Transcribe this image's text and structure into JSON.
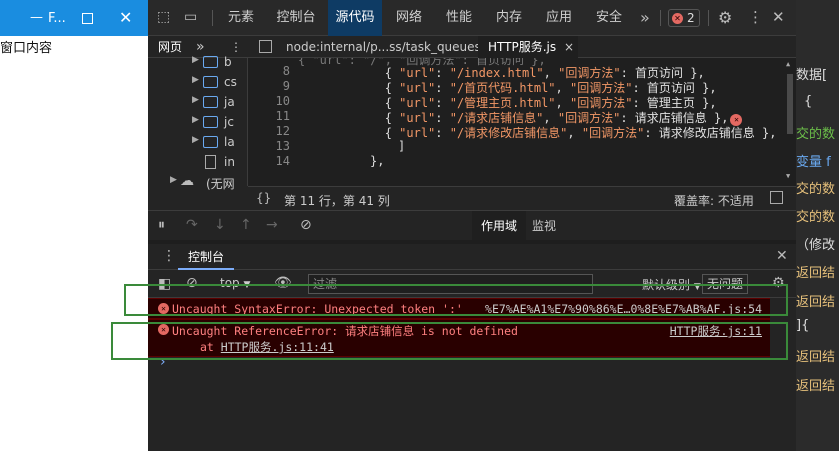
{
  "mini_window": {
    "title": "F...",
    "minimize": "—",
    "close": "✕",
    "content": "窗口内容"
  },
  "top_tabs": [
    "元素",
    "控制台",
    "源代码",
    "网络",
    "性能",
    "内存",
    "应用",
    "安全"
  ],
  "active_tab": "源代码",
  "error_badge": "2",
  "more_tabs": "»",
  "sub_bar": {
    "page_tab": "网页",
    "more": "»",
    "file_tab_1": "node:internal/p...ss/task_queues",
    "file_tab_2": "HTTP服务.js",
    "close": "×"
  },
  "tree": [
    {
      "type": "folder",
      "label": "b"
    },
    {
      "type": "folder",
      "label": "cs"
    },
    {
      "type": "folder",
      "label": "ja"
    },
    {
      "type": "folder",
      "label": "jc"
    },
    {
      "type": "folder",
      "label": "la"
    },
    {
      "type": "file",
      "label": "in"
    },
    {
      "type": "cloud",
      "label": "(无网"
    }
  ],
  "code_lines": [
    {
      "n": "8",
      "url": "\"/index.html\"",
      "method": "首页访问"
    },
    {
      "n": "9",
      "url": "\"/首页代码.html\"",
      "method": "首页访问"
    },
    {
      "n": "10",
      "url": "\"/管理主页.html\"",
      "method": "管理主页"
    },
    {
      "n": "11",
      "url": "\"/请求店铺信息\"",
      "method": "请求店铺信息"
    },
    {
      "n": "12",
      "url": "\"/请求修改店铺信息\"",
      "method": "请求修改店铺信息"
    }
  ],
  "code_extra": {
    "line13_n": "13",
    "line13": "]",
    "line14_n": "14",
    "line14": "},",
    "key_url": "\"url\"",
    "key_method": "\"回调方法\"",
    "top_partial": "{ \"url\": \"/\", \"回调方法\": 首页访问 },"
  },
  "status": {
    "braces": "{}",
    "position": "第 11 行，第 41 列",
    "coverage": "覆盖率: 不适用"
  },
  "debug_panel": {
    "scope": "作用域",
    "watch": "监视"
  },
  "console": {
    "title": "控制台",
    "context": "top",
    "filter_placeholder": "过滤",
    "level": "默认级别",
    "issues": "无问题",
    "errors": [
      {
        "msg": "Uncaught SyntaxError: Unexpected token ':'",
        "loc": "%E7%AE%A1%E7%90%86%E…0%8E%E7%AB%AF.js:54"
      },
      {
        "msg": "Uncaught ReferenceError: 请求店铺信息 is not defined",
        "loc": "HTTP服务.js:11",
        "at_prefix": "at ",
        "at_link": "HTTP服务.js:11:41"
      }
    ],
    "prompt": "›"
  },
  "right_window": {
    "lines": [
      "数据[",
      "{",
      "交的数",
      "变量 f",
      "交的数",
      "交的数",
      "（修改",
      "返回结",
      "返回结",
      "]{",
      "返回结",
      "返回结"
    ]
  }
}
